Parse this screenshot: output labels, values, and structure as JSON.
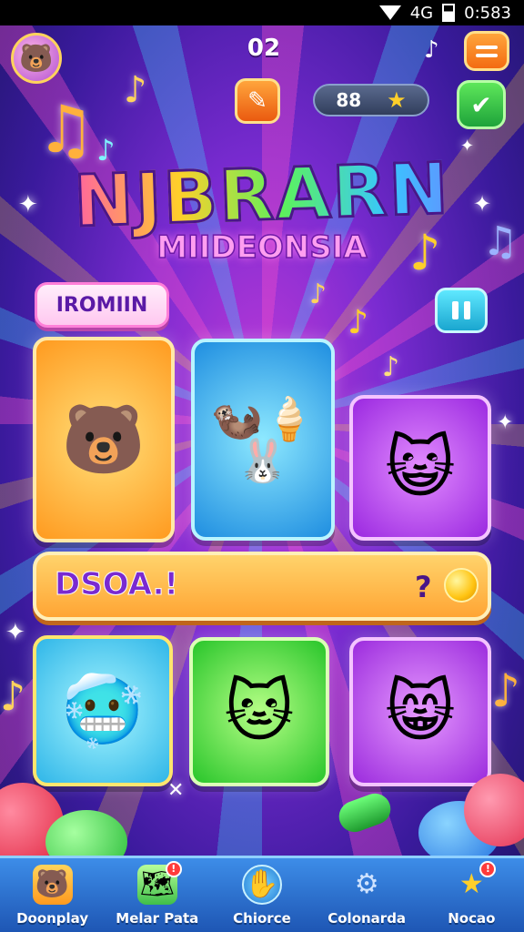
{
  "status_bar": {
    "network": "4G",
    "time": "0:583"
  },
  "header": {
    "level": "02",
    "stars_count": "88",
    "music_icon": "music-note-icon",
    "menu_icon": "hamburger-menu-icon"
  },
  "title": {
    "main": "NJBRARN",
    "sub": "MIIDEONSIA"
  },
  "section": {
    "label": "IROMIIN"
  },
  "banner": {
    "text": "DSOA.!",
    "count": "?"
  },
  "cards": [
    {
      "name": "bear-card",
      "icon": "dancing-bear-icon",
      "art": "🐻"
    },
    {
      "name": "forest-animals-card",
      "icon": "animals-cone-icon",
      "art": "🦦🍦🐰"
    },
    {
      "name": "cat-blob-card",
      "icon": "yellow-cat-icon",
      "art": "😺"
    },
    {
      "name": "blue-blob-card",
      "icon": "blue-blob-icon",
      "art": "🥶"
    },
    {
      "name": "white-cat-card",
      "icon": "white-cat-icon",
      "art": "🐱"
    },
    {
      "name": "orange-cat-card",
      "icon": "orange-cat-icon",
      "art": "😸"
    }
  ],
  "bottom_nav": [
    {
      "label": "Doonplay",
      "icon": "bear-star-icon",
      "badge": ""
    },
    {
      "label": "Melar Pata",
      "icon": "map-icon",
      "badge": "!"
    },
    {
      "label": "Chiorce",
      "icon": "hand-circle-icon",
      "badge": ""
    },
    {
      "label": "Colonarda",
      "icon": "gear-icon",
      "badge": ""
    },
    {
      "label": "Nocao",
      "icon": "star-icon",
      "badge": "!"
    }
  ],
  "colors": {
    "background": "#7a2bd1",
    "accent_orange": "#ff9a1f",
    "accent_green": "#28c52a",
    "nav_blue": "#1e56b4"
  }
}
